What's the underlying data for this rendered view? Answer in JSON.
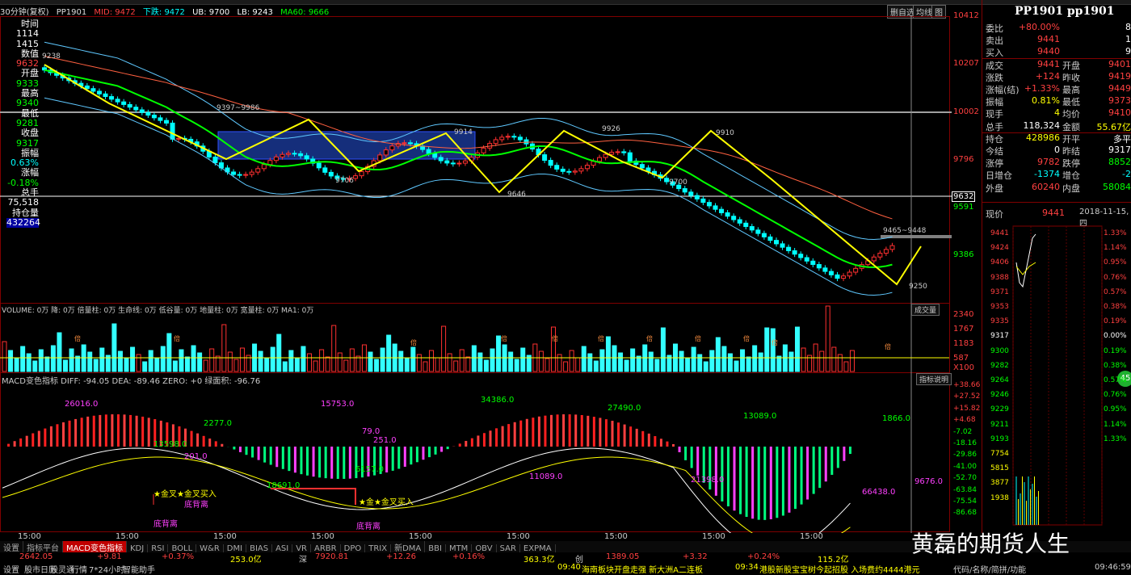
{
  "header": {
    "period": "30分钟(复权)",
    "symbol": "PP1901",
    "mid": "MID: 9472",
    "dn": "下跌: 9472",
    "ub": "UB: 9700",
    "lb": "LB: 9243",
    "ma60": "MA60: 9666",
    "buttons": [
      "删自选",
      "均线",
      "图"
    ]
  },
  "left_table": {
    "labels": [
      "时间",
      "数值",
      "开盘",
      "最高",
      "最低",
      "收盘",
      "振幅",
      "涨幅",
      "总手",
      "持仓量"
    ],
    "values": [
      "1114\n1415",
      "9632",
      "9333",
      "9340",
      "9281",
      "9317",
      "0.63%",
      "-0.18%",
      "75,518",
      "432264"
    ]
  },
  "price_axis": [
    "10412",
    "10207",
    "10002",
    "9796",
    "9591",
    "9386"
  ],
  "price_tags": {
    "current": "9632"
  },
  "chart_labels": {
    "levels": [
      "9238",
      "9397~9986",
      "9706",
      "9914",
      "9646",
      "9926",
      "9910",
      "9700",
      "9465~9448",
      "9250"
    ]
  },
  "volume": {
    "header": "VOLUME: 0万  降: 0万  倍量柱: 0万  生命线: 0万  低谷量: 0万  地量柱: 0万  宽量柱: 0万  MA1: 0万",
    "button": "成交量",
    "axis": [
      "2340",
      "1767",
      "1183",
      "587",
      "X100"
    ],
    "marker": "倍"
  },
  "macd": {
    "header": "MACD变色指标 DIFF: -94.05  DEA: -89.46  ZERO: +0  绿面积: -96.76",
    "button": "指标说明",
    "axis": [
      "+38.66",
      "+27.52",
      "+15.82",
      "+4.68",
      "-7.02",
      "-18.16",
      "-29.86",
      "-41.00",
      "-52.70",
      "-63.84",
      "-75.54",
      "-86.68"
    ],
    "labels": [
      "26016.0",
      "13598.0",
      "201.0",
      "2277.0",
      "15753.0",
      "18691.0",
      "79.0",
      "6157.0",
      "251.0",
      "34386.0",
      "11089.0",
      "27490.0",
      "21398.0",
      "13089.0",
      "66438.0",
      "1866.0",
      "9676.0"
    ],
    "annotations": [
      "★金叉★金叉买入",
      "底背离",
      "底背离",
      "★金★金叉买入",
      "底背离"
    ]
  },
  "time_axis": [
    "15:00",
    "15:00",
    "15:00",
    "15:00",
    "15:00",
    "15:00",
    "15:00",
    "15:00",
    "15:00"
  ],
  "quote": {
    "title": "PP1901 pp1901",
    "rows": [
      {
        "l1": "委比",
        "v1": "+80.00%",
        "c1": "#ff4040",
        "l2": "",
        "v2": "8",
        "c2": "#fff"
      },
      {
        "l1": "卖出",
        "v1": "9441",
        "c1": "#ff4040",
        "l2": "",
        "v2": "1",
        "c2": "#fff"
      },
      {
        "l1": "买入",
        "v1": "9440",
        "c1": "#ff4040",
        "l2": "",
        "v2": "9",
        "c2": "#fff"
      },
      {
        "l1": "成交",
        "v1": "9441",
        "c1": "#ff4040",
        "l2": "开盘",
        "v2": "9401",
        "c2": "#ff4040"
      },
      {
        "l1": "涨跌",
        "v1": "+124",
        "c1": "#ff4040",
        "l2": "昨收",
        "v2": "9419",
        "c2": "#ff4040"
      },
      {
        "l1": "涨幅(结)",
        "v1": "+1.33%",
        "c1": "#ff4040",
        "l2": "最高",
        "v2": "9449",
        "c2": "#ff4040"
      },
      {
        "l1": "振幅",
        "v1": "0.81%",
        "c1": "#ffff00",
        "l2": "最低",
        "v2": "9373",
        "c2": "#ff4040"
      },
      {
        "l1": "现手",
        "v1": "4",
        "c1": "#ffff00",
        "l2": "均价",
        "v2": "9410",
        "c2": "#ff4040"
      },
      {
        "l1": "总手",
        "v1": "118,324",
        "c1": "#ffffff",
        "l2": "金额",
        "v2": "55.67亿",
        "c2": "#ffff00"
      },
      {
        "l1": "持仓",
        "v1": "428986",
        "c1": "#ffff00",
        "l2": "开平",
        "v2": "多平",
        "c2": "#fff"
      },
      {
        "l1": "今结",
        "v1": "0",
        "c1": "#ffffff",
        "l2": "昨结",
        "v2": "9317",
        "c2": "#fff"
      },
      {
        "l1": "涨停",
        "v1": "9782",
        "c1": "#ff4040",
        "l2": "跌停",
        "v2": "8852",
        "c2": "#00ff00"
      },
      {
        "l1": "日增仓",
        "v1": "-1374",
        "c1": "#00ffff",
        "l2": "增仓",
        "v2": "-2",
        "c2": "#00ffff"
      },
      {
        "l1": "外盘",
        "v1": "60240",
        "c1": "#ff4040",
        "l2": "内盘",
        "v2": "58084",
        "c2": "#00ff00"
      }
    ],
    "now_label": "现价",
    "now_value": "9441",
    "date": "2018-11-15,四"
  },
  "mini": {
    "left_axis": [
      "9441",
      "9424",
      "9406",
      "9388",
      "9371",
      "9353",
      "9335",
      "9317",
      "9300",
      "9282",
      "9264",
      "9246",
      "9229",
      "9211",
      "9193",
      "7754",
      "5815",
      "3877",
      "1938"
    ],
    "right_axis": [
      "1.33%",
      "1.14%",
      "0.95%",
      "0.76%",
      "0.57%",
      "0.38%",
      "0.19%",
      "0.00%",
      "0.19%",
      "0.38%",
      "0.57%",
      "0.76%",
      "0.95%",
      "1.14%",
      "1.33%"
    ],
    "badge": "45"
  },
  "tabs": [
    "设置",
    "指标平台",
    "MACD变色指标",
    "KDJ",
    "RSI",
    "BOLL",
    "W&R",
    "DMI",
    "BIAS",
    "ASI",
    "VR",
    "ARBR",
    "DPO",
    "TRIX",
    "新DMA",
    "BBI",
    "MTM",
    "OBV",
    "SAR",
    "EXPMA"
  ],
  "status1": [
    "2642.05",
    "+9.81",
    "+0.37%",
    "253.0亿",
    "深",
    "7920.81",
    "+12.26",
    "+0.16%",
    "363.3亿",
    "创",
    "1389.05",
    "+3.32",
    "+0.24%",
    "115.2亿"
  ],
  "status2": [
    "设置",
    "股市日历",
    "股灵通",
    "行情",
    "7*24小时",
    "智能助手",
    "09:40",
    "海南板块开盘走强 新大洲A二连板",
    "09:34",
    "港股新股宝宝树今起招股 入场费约4444港元",
    "代码/名称/简拼/功能",
    "09:46:59"
  ],
  "watermark": "黄磊的期货人生"
}
